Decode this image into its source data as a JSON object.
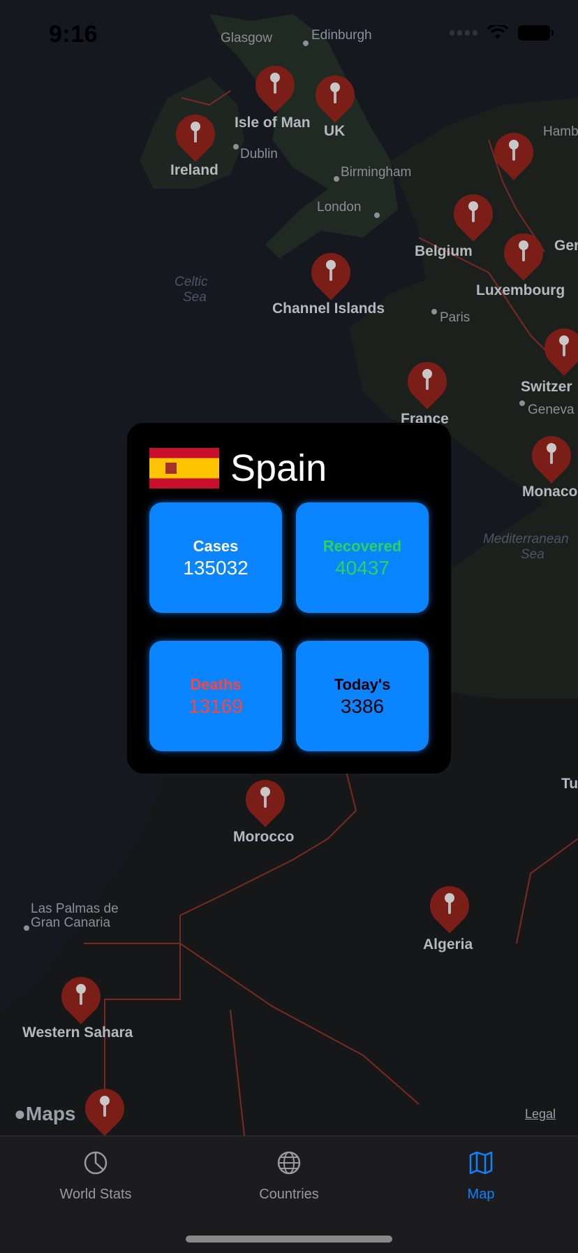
{
  "status_bar": {
    "time": "9:16"
  },
  "map": {
    "country_labels": [
      "Ireland",
      "Isle of Man",
      "UK",
      "Belgium",
      "Luxembourg",
      "Channel Islands",
      "France",
      "Switzer",
      "Monaco",
      "Ger",
      "Morocco",
      "Algeria",
      "Western Sahara",
      "Tu"
    ],
    "city_labels": [
      "Glasgow",
      "Edinburgh",
      "Dublin",
      "Birmingham",
      "London",
      "Paris",
      "Geneva",
      "Hamb",
      "Las Palmas de",
      "Gran Canaria"
    ],
    "water_labels": [
      "Celtic",
      "Sea",
      "Mediterranean",
      "Sea"
    ],
    "maps_logo": "Maps",
    "legal": "Legal"
  },
  "popup": {
    "country": "Spain",
    "flag": "spain-flag",
    "tiles": [
      {
        "label": "Cases",
        "value": "135032",
        "color": "#ffffff"
      },
      {
        "label": "Recovered",
        "value": "40437",
        "color": "#30d158"
      },
      {
        "label": "Deaths",
        "value": "13169",
        "color": "#ff453a"
      },
      {
        "label": "Today's",
        "value": "3386",
        "color": "#000000"
      }
    ]
  },
  "tab_bar": {
    "tabs": [
      {
        "label": "World Stats",
        "icon": "chart-pie-icon",
        "active": false
      },
      {
        "label": "Countries",
        "icon": "globe-icon",
        "active": false
      },
      {
        "label": "Map",
        "icon": "map-icon",
        "active": true
      }
    ],
    "active_color": "#0a84ff",
    "inactive_color": "#9a9a9e"
  }
}
